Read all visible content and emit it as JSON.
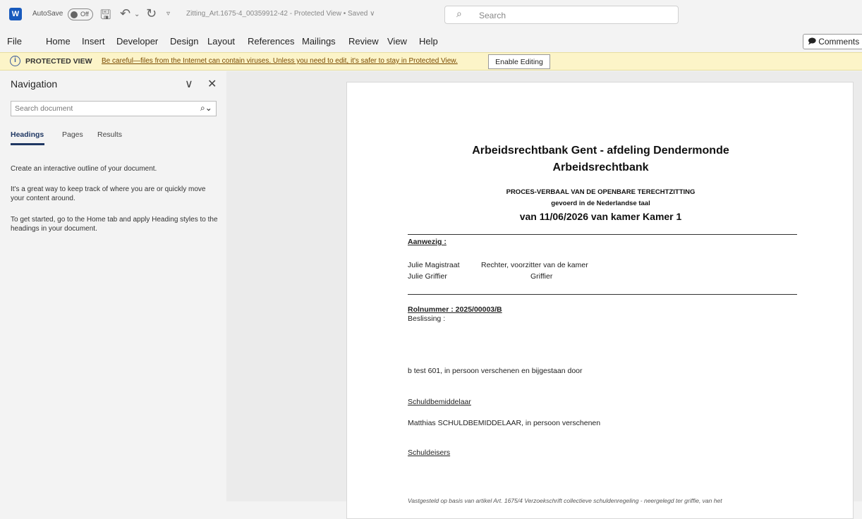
{
  "titlebar": {
    "app_icon": "word-icon",
    "autosave_label": "AutoSave",
    "autosave_state": "Off",
    "doc_title": "Zitting_Art.1675-4_00359912-42  -  Protected View • Saved ∨",
    "search_placeholder": "Search"
  },
  "menu": {
    "items": [
      "File",
      "Home",
      "Insert",
      "Developer",
      "Design",
      "Layout",
      "References",
      "Mailings",
      "Review",
      "View",
      "Help"
    ],
    "comments_label": "Comments"
  },
  "protected_view": {
    "title": "PROTECTED VIEW",
    "message": "Be careful—files from the Internet can contain viruses. Unless you need to edit, it's safer to stay in Protected View.",
    "button": "Enable Editing"
  },
  "navigation": {
    "title": "Navigation",
    "search_placeholder": "Search document",
    "tabs": [
      "Headings",
      "Pages",
      "Results"
    ],
    "active_tab": "Headings",
    "paragraphs": [
      "Create an interactive outline of your document.",
      "It's a great way to keep track of where you are or quickly move your content around.",
      "To get started, go to the Home tab and apply Heading styles to the headings in your document."
    ]
  },
  "document": {
    "court_line1": "Arbeidsrechtbank Gent - afdeling Dendermonde",
    "court_line2": "Arbeidsrechtbank",
    "pv_title": "PROCES-VERBAAL VAN DE OPENBARE TERECHTZITTING",
    "pv_lang": "gevoerd in de Nederlandse taal",
    "session": "van 11/06/2026 van kamer Kamer 1",
    "aanwezig_label": "Aanwezig :",
    "persons": [
      {
        "name": "Julie Magistraat",
        "role": "Rechter, voorzitter van de kamer"
      },
      {
        "name": "Julie Griffier",
        "role": "Griffier"
      }
    ],
    "rolnummer": "Rolnummer : 2025/00003/B",
    "beslissing": "Beslissing :",
    "party_line": "b test 601, in persoon verschenen en bijgestaan door",
    "schuldbemiddelaar_label": "Schuldbemiddelaar",
    "schuldbemiddelaar_line": "Matthias SCHULDBEMIDDELAAR, in persoon verschenen",
    "schuldeisers_label": "Schuldeisers",
    "footer_cut": "Vastgesteld op basis van artikel Art. 1675/4 Verzoekschrift collectieve schuldenregeling - neergelegd ter griffie, van het"
  }
}
